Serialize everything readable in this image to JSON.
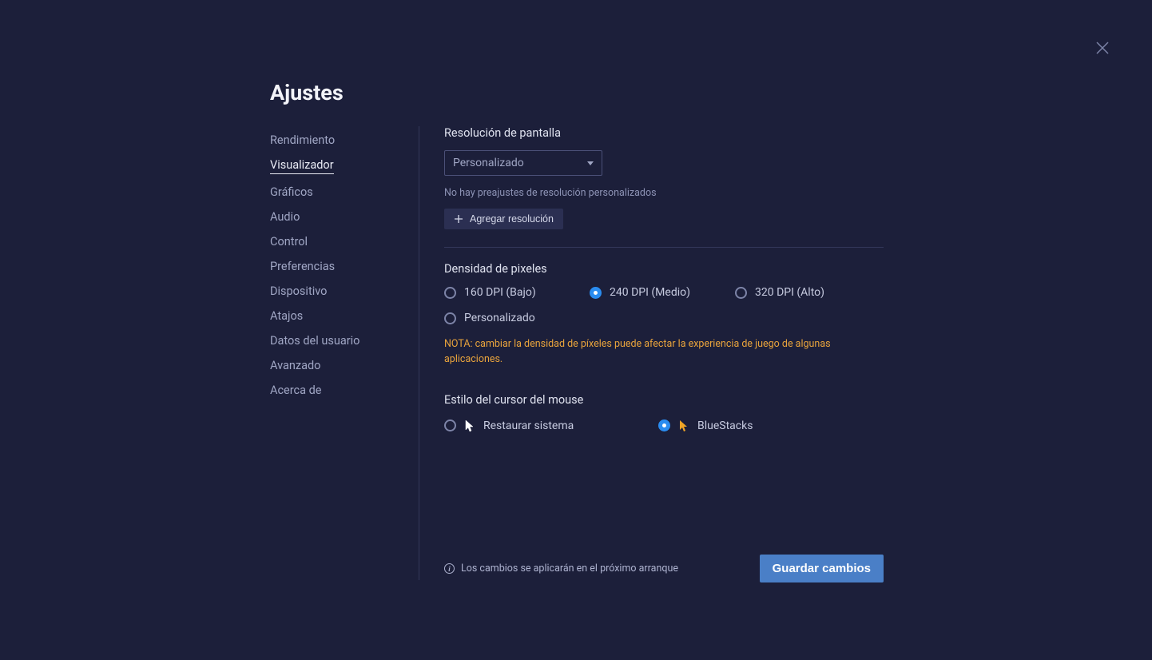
{
  "title": "Ajustes",
  "sidebar": {
    "items": [
      {
        "label": "Rendimiento"
      },
      {
        "label": "Visualizador"
      },
      {
        "label": "Gráficos"
      },
      {
        "label": "Audio"
      },
      {
        "label": "Control"
      },
      {
        "label": "Preferencias"
      },
      {
        "label": "Dispositivo"
      },
      {
        "label": "Atajos"
      },
      {
        "label": "Datos del usuario"
      },
      {
        "label": "Avanzado"
      },
      {
        "label": "Acerca de"
      }
    ],
    "active_index": 1
  },
  "resolution": {
    "title": "Resolución de pantalla",
    "selected": "Personalizado",
    "helper": "No hay preajustes de resolución personalizados",
    "add_button": "Agregar resolución"
  },
  "density": {
    "title": "Densidad de pixeles",
    "options": [
      {
        "label": "160 DPI (Bajo)",
        "selected": false
      },
      {
        "label": "240 DPI (Medio)",
        "selected": true
      },
      {
        "label": "320 DPI (Alto)",
        "selected": false
      },
      {
        "label": "Personalizado",
        "selected": false
      }
    ],
    "note": "NOTA: cambiar la densidad de píxeles puede afectar la experiencia de juego de algunas aplicaciones."
  },
  "cursor": {
    "title": "Estilo del cursor del mouse",
    "options": [
      {
        "label": "Restaurar sistema",
        "selected": false
      },
      {
        "label": "BlueStacks",
        "selected": true
      }
    ]
  },
  "footer": {
    "note": "Los cambios se aplicarán en el próximo arranque",
    "save": "Guardar cambios"
  }
}
